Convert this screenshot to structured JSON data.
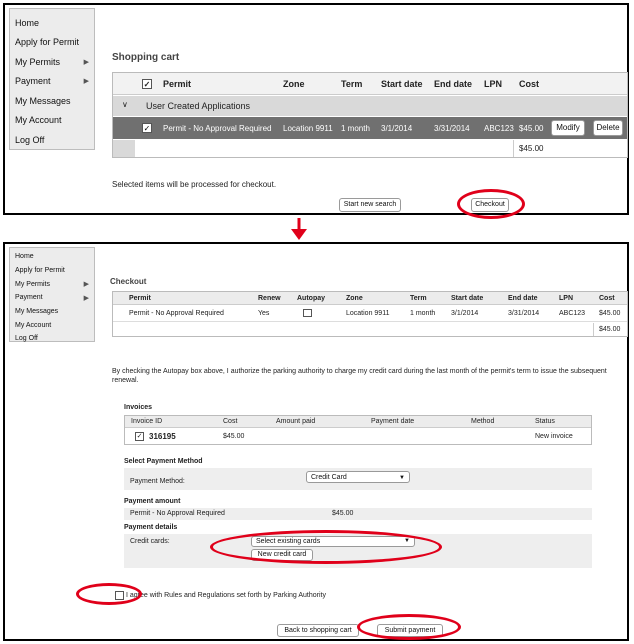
{
  "top": {
    "menu": [
      {
        "label": "Home",
        "arrow": false
      },
      {
        "label": "Apply for Permit",
        "arrow": false
      },
      {
        "label": "My Permits",
        "arrow": true
      },
      {
        "label": "Payment",
        "arrow": true
      },
      {
        "label": "My Messages",
        "arrow": false
      },
      {
        "label": "My Account",
        "arrow": false
      },
      {
        "label": "Log Off",
        "arrow": false
      }
    ],
    "title": "Shopping cart",
    "headers": {
      "permit": "Permit",
      "zone": "Zone",
      "term": "Term",
      "start": "Start date",
      "end": "End date",
      "lpn": "LPN",
      "cost": "Cost"
    },
    "group_label": "User Created Applications",
    "group_toggle": "∨",
    "row": {
      "permit": "Permit - No Approval Required",
      "zone": "Location 9911",
      "term": "1 month",
      "start": "3/1/2014",
      "end": "3/31/2014",
      "lpn": "ABC123",
      "cost": "$45.00"
    },
    "modify_label": "Modify",
    "delete_label": "Delete",
    "total": "$45.00",
    "note": "Selected items will be processed for checkout.",
    "new_search_label": "Start new search",
    "checkout_label": "Checkout"
  },
  "arrow_color": "#e0001a",
  "bottom": {
    "menu": [
      {
        "label": "Home",
        "arrow": false
      },
      {
        "label": "Apply for Permit",
        "arrow": false
      },
      {
        "label": "My Permits",
        "arrow": true
      },
      {
        "label": "Payment",
        "arrow": true
      },
      {
        "label": "My Messages",
        "arrow": false
      },
      {
        "label": "My Account",
        "arrow": false
      },
      {
        "label": "Log Off",
        "arrow": false
      }
    ],
    "title": "Checkout",
    "headers": {
      "permit": "Permit",
      "renew": "Renew",
      "autopay": "Autopay",
      "zone": "Zone",
      "term": "Term",
      "start": "Start date",
      "end": "End date",
      "lpn": "LPN",
      "cost": "Cost"
    },
    "row": {
      "permit": "Permit - No Approval Required",
      "renew": "Yes",
      "zone": "Location 9911",
      "term": "1 month",
      "start": "3/1/2014",
      "end": "3/31/2014",
      "lpn": "ABC123",
      "cost": "$45.00"
    },
    "total": "$45.00",
    "autopay_note": "By checking the Autopay box above, I authorize the parking authority to charge my credit card during the last month of the permit's term to issue the subsequent renewal.",
    "invoices": {
      "title": "Invoices",
      "headers": {
        "id": "Invoice ID",
        "cost": "Cost",
        "paid": "Amount paid",
        "date": "Payment date",
        "method": "Method",
        "status": "Status"
      },
      "row": {
        "id": "316195",
        "cost": "$45.00",
        "status": "New invoice"
      }
    },
    "pay_method_title": "Select Payment Method",
    "pay_method_label": "Payment Method:",
    "pay_method_value": "Credit Card",
    "amount_title": "Payment amount",
    "amount_item": "Permit - No Approval Required",
    "amount_value": "$45.00",
    "details_title": "Payment details",
    "cards_label": "Credit cards:",
    "cards_value": "Select existing cards",
    "new_card_label": "New credit card",
    "agree_text": "I agree with Rules and Regulations set forth by Parking Authority",
    "back_label": "Back to shopping cart",
    "submit_label": "Submit payment"
  }
}
